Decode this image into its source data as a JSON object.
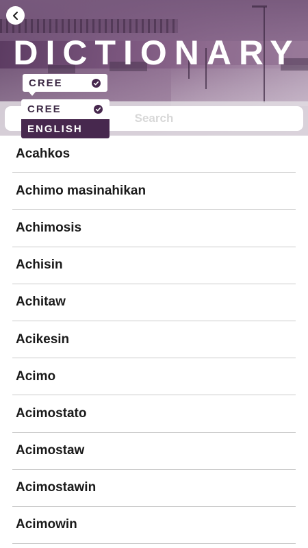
{
  "header": {
    "title": "DICTIONARY",
    "back_icon": "chevron-left-icon"
  },
  "language_selector": {
    "selected": "CREE",
    "check_icon": "check-circle-icon",
    "options": [
      "CREE",
      "ENGLISH"
    ]
  },
  "search": {
    "placeholder": "Search",
    "value": ""
  },
  "words": [
    "Acahkos",
    "Achimo masinahikan",
    "Achimosis",
    "Achisin",
    "Achitaw",
    "Acikesin",
    "Acimo",
    "Acimostato",
    "Acimostaw",
    "Acimostawin",
    "Acimowin"
  ],
  "colors": {
    "accent": "#47284e",
    "header_tint": "#7b567e",
    "text": "#1a1a1a",
    "divider": "#c9c9c9"
  }
}
